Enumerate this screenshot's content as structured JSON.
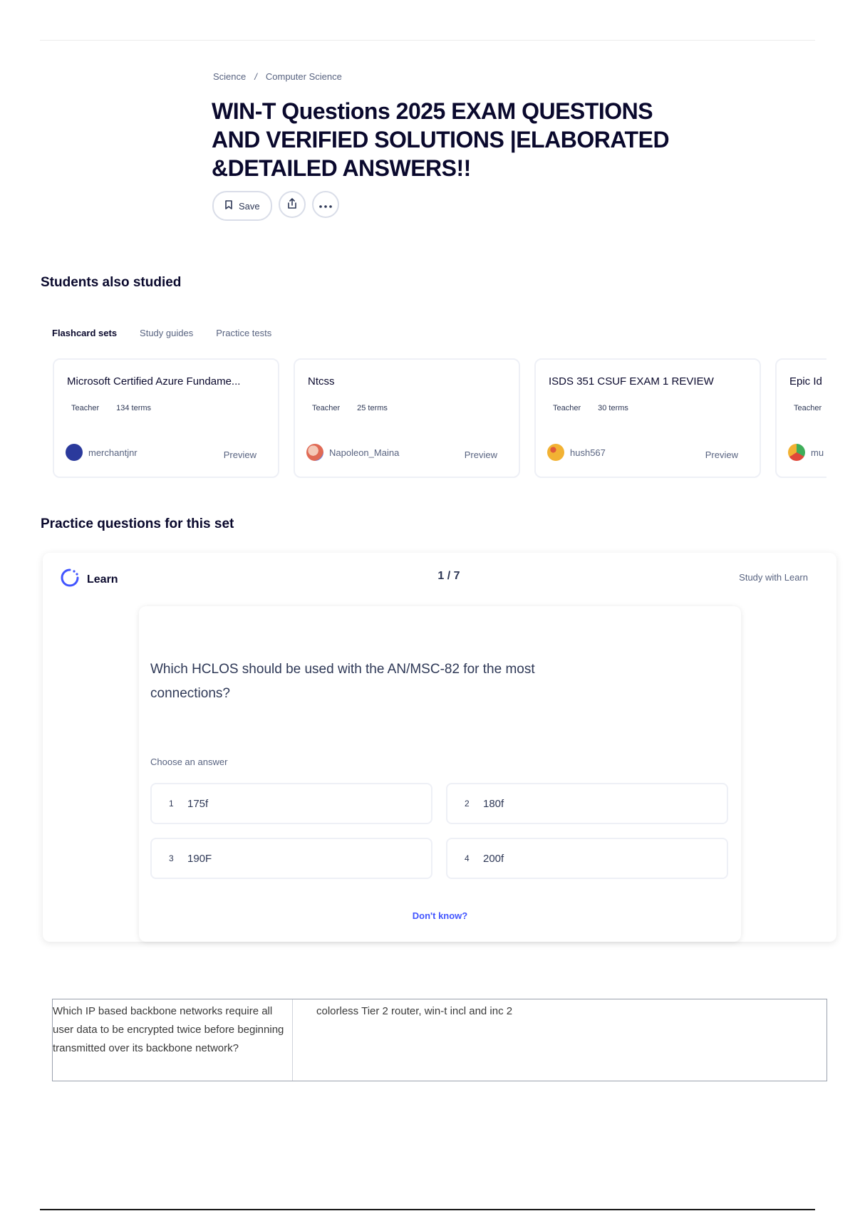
{
  "breadcrumb": {
    "items": [
      "Science",
      "Computer Science"
    ],
    "separator": "/"
  },
  "title": "WIN-T Questions 2025 EXAM QUESTIONS AND VERIFIED SOLUTIONS |ELABORATED &DETAILED ANSWERS!!",
  "actions": {
    "save_label": "Save",
    "share_icon": "share-icon",
    "more_icon": "more-icon"
  },
  "also_studied": {
    "heading": "Students also studied",
    "tabs": [
      "Flashcard sets",
      "Study guides",
      "Practice tests"
    ],
    "cards": [
      {
        "title": "Microsoft Certified Azure Fundame...",
        "role": "Teacher",
        "terms": "134 terms",
        "user": "merchantjnr",
        "preview": "Preview",
        "avatar_color": "#2b3a9c"
      },
      {
        "title": "Ntcss",
        "role": "Teacher",
        "terms": "25 terms",
        "user": "Napoleon_Maina",
        "preview": "Preview",
        "avatar_color": "#e06a55"
      },
      {
        "title": "ISDS 351 CSUF EXAM 1 REVIEW",
        "role": "Teacher",
        "terms": "30 terms",
        "user": "hush567",
        "preview": "Preview",
        "avatar_color": "#f2b233"
      },
      {
        "title": "Epic Id",
        "role": "Teacher",
        "terms": "",
        "user": "mu",
        "preview": "",
        "avatar_color": "#3fae5a"
      }
    ]
  },
  "practice": {
    "heading": "Practice questions for this set",
    "learn_label": "Learn",
    "counter": "1 / 7",
    "study_link": "Study with Learn",
    "question": "Which HCLOS should be used with the AN/MSC-82 for the most connections?",
    "choose_label": "Choose an answer",
    "options": [
      {
        "num": "1",
        "text": "175f"
      },
      {
        "num": "2",
        "text": "180f"
      },
      {
        "num": "3",
        "text": "190F"
      },
      {
        "num": "4",
        "text": "200f"
      }
    ],
    "dont_know": "Don't know?"
  },
  "term_row": {
    "term": "Which IP based backbone networks require all user data to be encrypted twice before beginning transmitted over its backbone network?",
    "definition": "colorless Tier 2 router, win-t incl and inc 2"
  },
  "colors": {
    "accent": "#4255ff",
    "text": "#0a092d",
    "muted": "#586380"
  }
}
